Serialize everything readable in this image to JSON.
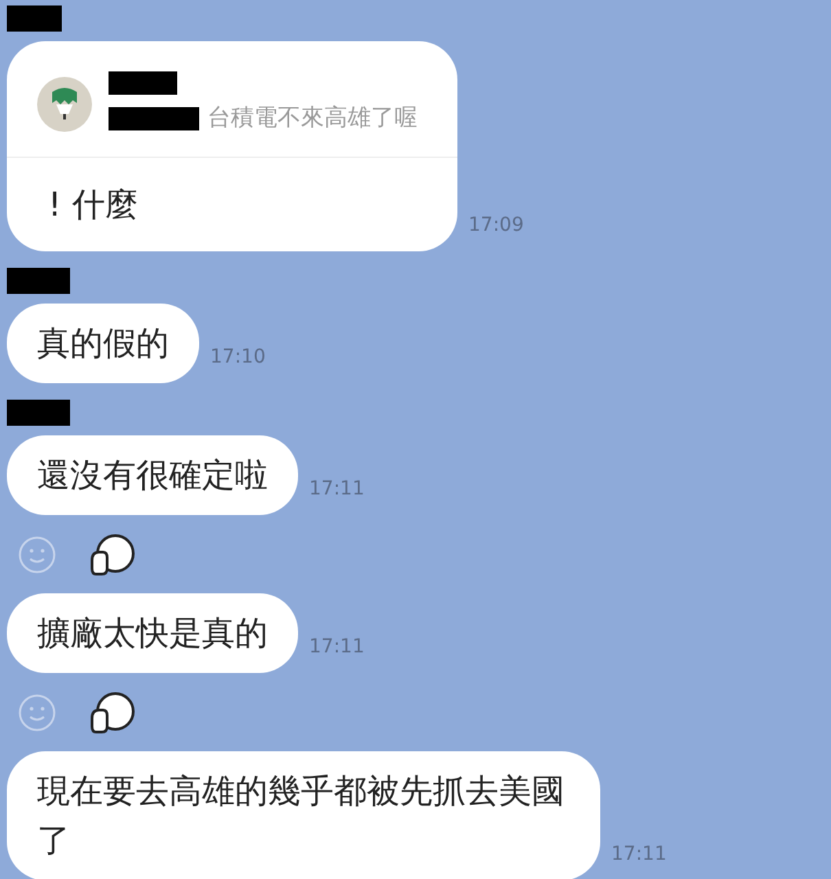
{
  "messages": [
    {
      "kind": "reply",
      "show_sender": true,
      "quote": {
        "text": "台積電不來高雄了喔"
      },
      "text": "! 什麼",
      "time": "17:09",
      "reaction": false
    },
    {
      "kind": "text",
      "show_sender": true,
      "text": "真的假的",
      "time": "17:10",
      "reaction": false
    },
    {
      "kind": "text",
      "show_sender": true,
      "text": "還沒有很確定啦",
      "time": "17:11",
      "reaction": true
    },
    {
      "kind": "text",
      "show_sender": false,
      "text": "擴廠太快是真的",
      "time": "17:11",
      "reaction": true
    },
    {
      "kind": "text",
      "show_sender": false,
      "text": "現在要去高雄的幾乎都被先抓去美國了",
      "time": "17:11",
      "reaction": false
    }
  ]
}
